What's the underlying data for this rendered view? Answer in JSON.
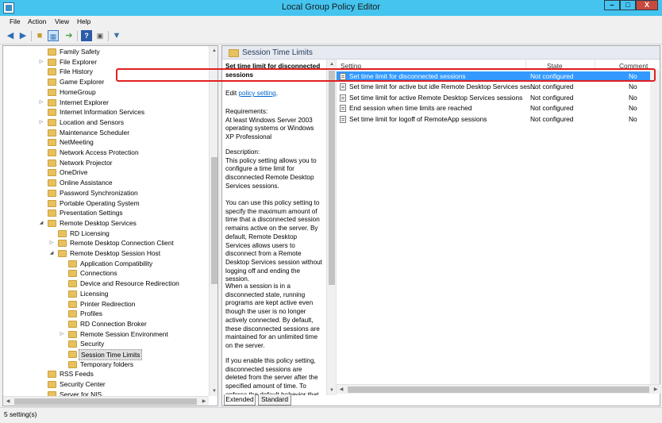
{
  "window": {
    "title": "Local Group Policy Editor",
    "minimize": "–",
    "restore": "□",
    "close": "X"
  },
  "menu": [
    "File",
    "Action",
    "View",
    "Help"
  ],
  "tree": [
    {
      "label": "Family Safety",
      "indent": 0,
      "arrow": ""
    },
    {
      "label": "File Explorer",
      "indent": 0,
      "arrow": "▷"
    },
    {
      "label": "File History",
      "indent": 0,
      "arrow": ""
    },
    {
      "label": "Game Explorer",
      "indent": 0,
      "arrow": ""
    },
    {
      "label": "HomeGroup",
      "indent": 0,
      "arrow": ""
    },
    {
      "label": "Internet Explorer",
      "indent": 0,
      "arrow": "▷"
    },
    {
      "label": "Internet Information Services",
      "indent": 0,
      "arrow": ""
    },
    {
      "label": "Location and Sensors",
      "indent": 0,
      "arrow": "▷"
    },
    {
      "label": "Maintenance Scheduler",
      "indent": 0,
      "arrow": ""
    },
    {
      "label": "NetMeeting",
      "indent": 0,
      "arrow": ""
    },
    {
      "label": "Network Access Protection",
      "indent": 0,
      "arrow": ""
    },
    {
      "label": "Network Projector",
      "indent": 0,
      "arrow": ""
    },
    {
      "label": "OneDrive",
      "indent": 0,
      "arrow": ""
    },
    {
      "label": "Online Assistance",
      "indent": 0,
      "arrow": ""
    },
    {
      "label": "Password Synchronization",
      "indent": 0,
      "arrow": ""
    },
    {
      "label": "Portable Operating System",
      "indent": 0,
      "arrow": ""
    },
    {
      "label": "Presentation Settings",
      "indent": 0,
      "arrow": ""
    },
    {
      "label": "Remote Desktop Services",
      "indent": 0,
      "arrow": "◢"
    },
    {
      "label": "RD Licensing",
      "indent": 1,
      "arrow": ""
    },
    {
      "label": "Remote Desktop Connection Client",
      "indent": 1,
      "arrow": "▷"
    },
    {
      "label": "Remote Desktop Session Host",
      "indent": 1,
      "arrow": "◢"
    },
    {
      "label": "Application Compatibility",
      "indent": 2,
      "arrow": ""
    },
    {
      "label": "Connections",
      "indent": 2,
      "arrow": ""
    },
    {
      "label": "Device and Resource Redirection",
      "indent": 2,
      "arrow": ""
    },
    {
      "label": "Licensing",
      "indent": 2,
      "arrow": ""
    },
    {
      "label": "Printer Redirection",
      "indent": 2,
      "arrow": ""
    },
    {
      "label": "Profiles",
      "indent": 2,
      "arrow": ""
    },
    {
      "label": "RD Connection Broker",
      "indent": 2,
      "arrow": ""
    },
    {
      "label": "Remote Session Environment",
      "indent": 2,
      "arrow": "▷"
    },
    {
      "label": "Security",
      "indent": 2,
      "arrow": ""
    },
    {
      "label": "Session Time Limits",
      "indent": 2,
      "arrow": "",
      "selected": true
    },
    {
      "label": "Temporary folders",
      "indent": 2,
      "arrow": ""
    },
    {
      "label": "RSS Feeds",
      "indent": 0,
      "arrow": ""
    },
    {
      "label": "Security Center",
      "indent": 0,
      "arrow": ""
    },
    {
      "label": "Server for NIS",
      "indent": 0,
      "arrow": ""
    }
  ],
  "panel": {
    "title": "Session Time Limits"
  },
  "desc": {
    "heading": "Set time limit for disconnected sessions",
    "edit_prefix": "Edit ",
    "edit_link": "policy setting",
    "edit_suffix": ".",
    "requirements": "Requirements:\nAt least Windows Server 2003 operating systems or Windows XP Professional",
    "p1": "Description:\nThis policy setting allows you to configure a time limit for disconnected Remote Desktop Services sessions.",
    "p2": "You can use this policy setting to specify the maximum amount of time that a disconnected session remains active on the server. By default, Remote Desktop Services allows users to disconnect from a Remote Desktop Services session without logging off and ending the session.",
    "p3": "When a session is in a disconnected state, running programs are kept active even though the user is no longer actively connected. By default, these disconnected sessions are maintained for an unlimited time on the server.",
    "p4": "If you enable this policy setting, disconnected sessions are deleted from the server after the specified amount of time. To enforce the default behavior that"
  },
  "grid": {
    "columns": {
      "setting": "Setting",
      "state": "State",
      "comment": "Comment"
    },
    "rows": [
      {
        "setting": "Set time limit for disconnected sessions",
        "state": "Not configured",
        "comment": "No"
      },
      {
        "setting": "Set time limit for active but idle Remote Desktop Services ses...",
        "state": "Not configured",
        "comment": "No"
      },
      {
        "setting": "Set time limit for active Remote Desktop Services sessions",
        "state": "Not configured",
        "comment": "No"
      },
      {
        "setting": "End session when time limits are reached",
        "state": "Not configured",
        "comment": "No"
      },
      {
        "setting": "Set time limit for logoff of RemoteApp sessions",
        "state": "Not configured",
        "comment": "No"
      }
    ]
  },
  "tabs": [
    "Extended",
    "Standard"
  ],
  "status": "5 setting(s)",
  "colors": {
    "titlebar": "#44c4ee",
    "selection": "#3399ff",
    "highlight_box": "#e02020"
  }
}
